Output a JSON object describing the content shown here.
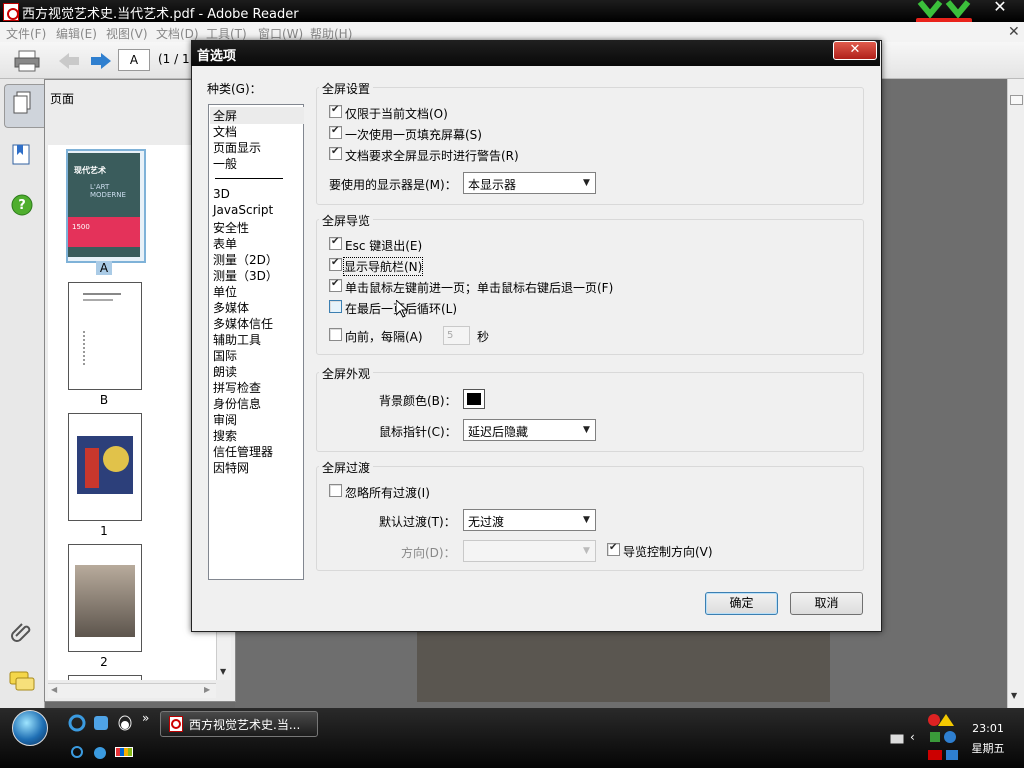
{
  "window": {
    "title": "西方视觉艺术史.当代艺术.pdf - Adobe Reader"
  },
  "menubar": [
    "文件(F)",
    "编辑(E)",
    "视图(V)",
    "文档(D)",
    "工具(T)",
    "窗口(W)",
    "帮助(H)"
  ],
  "toolbar": {
    "page_value": "A",
    "page_count": "(1 / 1"
  },
  "pages_panel": {
    "title": "页面",
    "thumbnails": [
      {
        "label": "A",
        "cover_title": "现代艺术",
        "cover_sub": "L'ART MODERNE",
        "cover_year": "1500"
      },
      {
        "label": "B"
      },
      {
        "label": "1"
      },
      {
        "label": "2"
      }
    ]
  },
  "dialog": {
    "title": "首选项",
    "category_label": "种类(G)：",
    "categories_top": [
      "全屏",
      "文档",
      "页面显示",
      "一般"
    ],
    "categories_bottom": [
      "3D",
      "JavaScript",
      "安全性",
      "表单",
      "测量（2D）",
      "测量（3D）",
      "单位",
      "多媒体",
      "多媒体信任",
      "辅助工具",
      "国际",
      "朗读",
      "拼写检查",
      "身份信息",
      "审阅",
      "搜索",
      "信任管理器",
      "因特网"
    ],
    "fs_settings": {
      "title": "全屏设置",
      "only_current_doc": "仅限于当前文档(O)",
      "fill_screen": "一次使用一页填充屏幕(S)",
      "alert": "文档要求全屏显示时进行警告(R)",
      "monitor_label": "要使用的显示器是(M)：",
      "monitor_value": "本显示器"
    },
    "fs_navigation": {
      "title": "全屏导览",
      "esc_exit": "Esc 键退出(E)",
      "show_nav_bar": "显示导航栏(N)",
      "click_advance": "单击鼠标左键前进一页；单击鼠标右键后退一页(F)",
      "loop": "在最后一页后循环(L)",
      "advance_every": "向前，每隔(A)",
      "interval_value": "5",
      "seconds": "秒"
    },
    "fs_appearance": {
      "title": "全屏外观",
      "bg_color_label": "背景颜色(B)：",
      "bg_color": "#000000",
      "cursor_label": "鼠标指针(C)：",
      "cursor_value": "延迟后隐藏"
    },
    "fs_transitions": {
      "title": "全屏过渡",
      "ignore_all": "忽略所有过渡(I)",
      "default_label": "默认过渡(T)：",
      "default_value": "无过渡",
      "direction_label": "方向(D)：",
      "direction_value": "",
      "nav_direction": "导览控制方向(V)"
    },
    "ok": "确定",
    "cancel": "取消"
  },
  "taskbar": {
    "task_label": "西方视觉艺术史.当...",
    "time": "23:01",
    "weekday": "星期五"
  },
  "colors": {
    "accent": "#3c7fb1",
    "dialog_bg": "#f0f0f0",
    "titlebar": "#000000"
  },
  "icons": [
    "pdf-icon",
    "print-icon",
    "back-icon",
    "forward-icon",
    "pages-icon",
    "bookmarks-icon",
    "help-icon",
    "attachment-icon",
    "comments-icon",
    "start-icon",
    "ie-icon",
    "qq-icon",
    "chevron-down-icon",
    "close-icon"
  ]
}
